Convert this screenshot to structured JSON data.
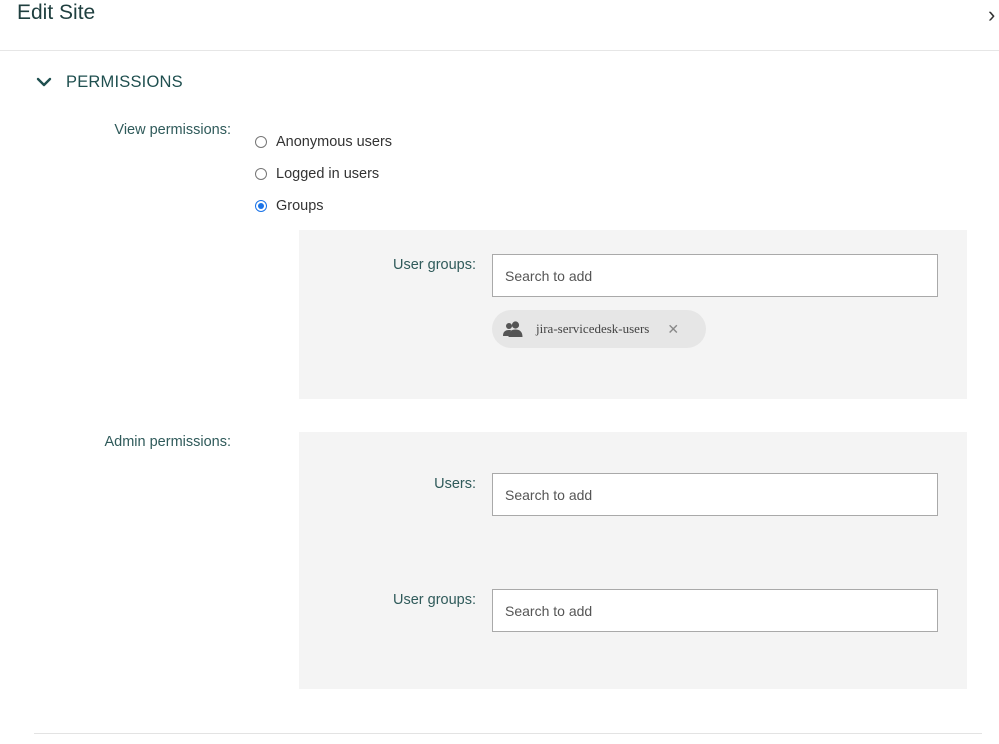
{
  "dialog": {
    "title": "Edit Site",
    "close_glyph": "›"
  },
  "section": {
    "title": "PERMISSIONS",
    "icon": "chevron-down-icon"
  },
  "view_permissions": {
    "label": "View permissions:",
    "options": [
      {
        "label": "Anonymous users",
        "selected": false
      },
      {
        "label": "Logged in users",
        "selected": false
      },
      {
        "label": "Groups",
        "selected": true
      }
    ],
    "user_groups": {
      "label": "User groups:",
      "placeholder": "Search to add",
      "value": "",
      "chips": [
        {
          "label": "jira-servicedesk-users",
          "icon": "user-group-icon",
          "remove_glyph": "✕"
        }
      ]
    }
  },
  "admin_permissions": {
    "label": "Admin permissions:",
    "users": {
      "label": "Users:",
      "placeholder": "Search to add",
      "value": ""
    },
    "user_groups": {
      "label": "User groups:",
      "placeholder": "Search to add",
      "value": ""
    }
  },
  "colors": {
    "accent": "#1a73e8",
    "label_text": "#2f5a5a",
    "panel_bg": "#f4f4f4",
    "chip_bg": "#e6e6e6"
  }
}
